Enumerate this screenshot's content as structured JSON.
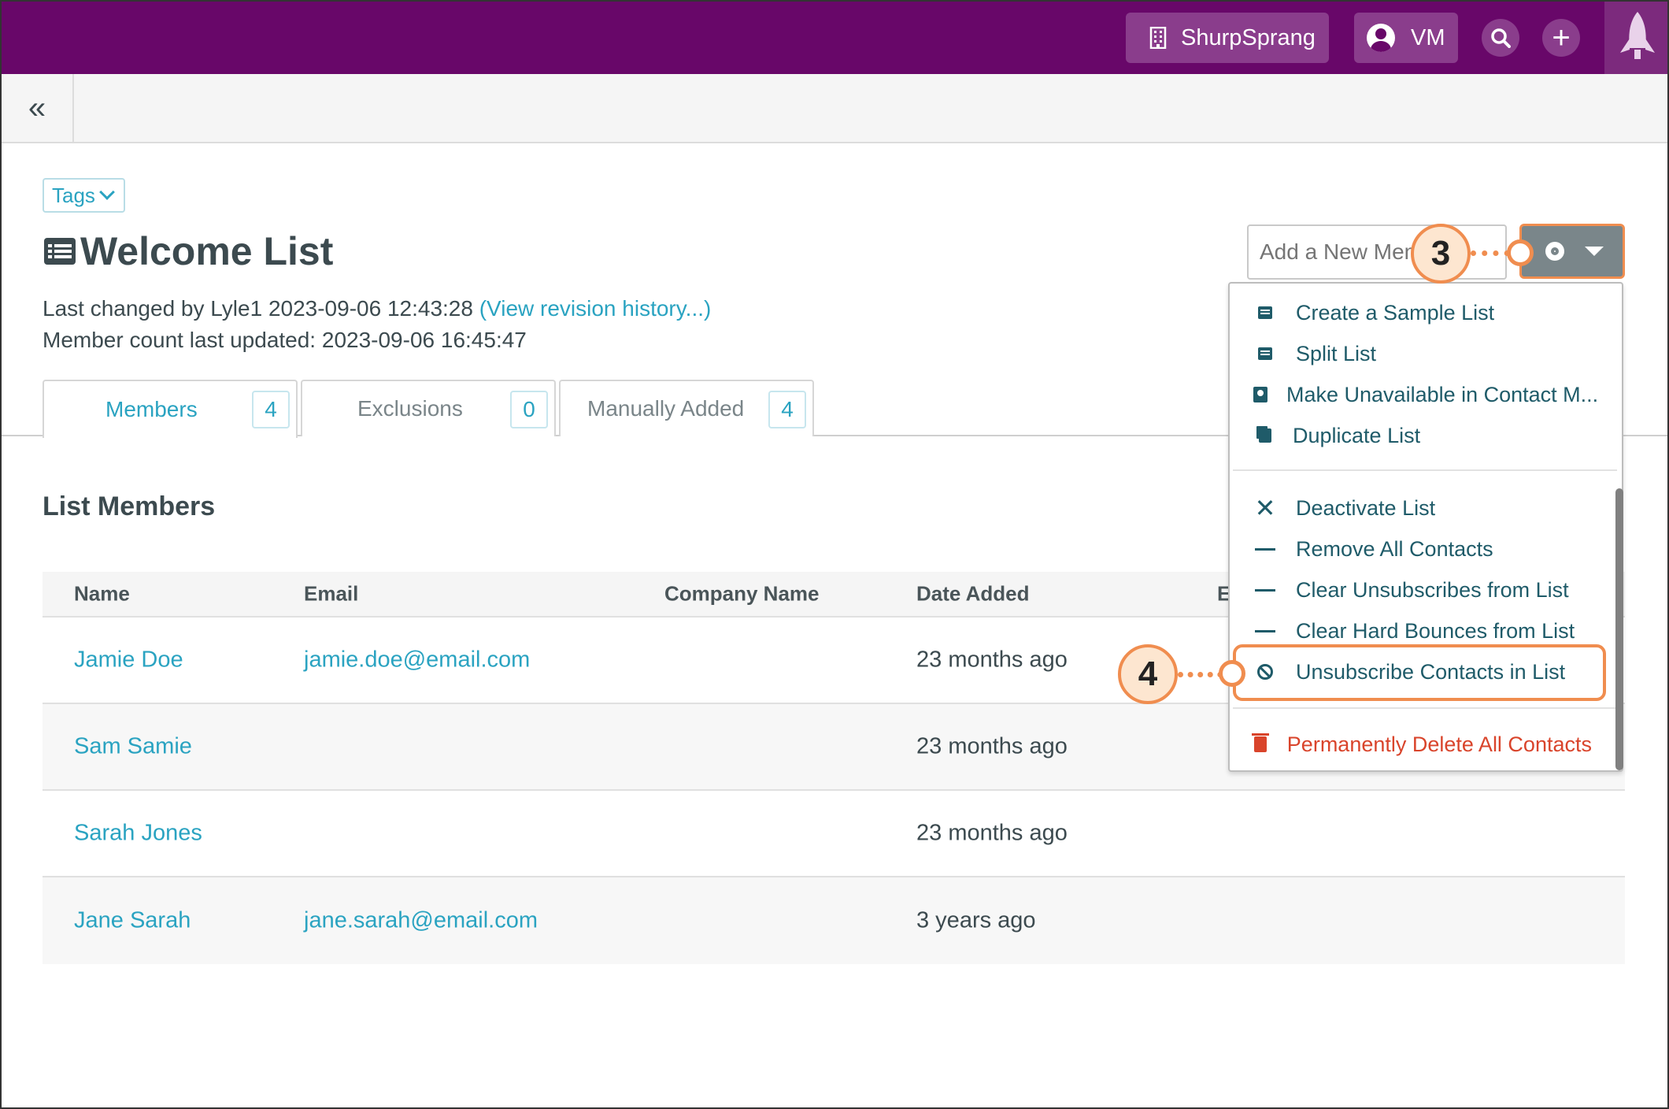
{
  "topbar": {
    "org_name": "ShurpSprang",
    "user_initials": "VM",
    "plus_label": "+"
  },
  "subbar": {
    "collapse_label": "«"
  },
  "tags": {
    "label": "Tags"
  },
  "list": {
    "title": "Welcome List",
    "last_changed": "Last changed by Lyle1 2023-09-06 12:43:28 ",
    "revision_link": "(View revision history...)",
    "member_count_updated": "Member count last updated: 2023-09-06 16:45:47"
  },
  "tabs": [
    {
      "label": "Members",
      "count": "4"
    },
    {
      "label": "Exclusions",
      "count": "0"
    },
    {
      "label": "Manually Added",
      "count": "4"
    }
  ],
  "section_title": "List Members",
  "table": {
    "headers": [
      "Name",
      "Email",
      "Company Name",
      "Date Added",
      "E"
    ],
    "rows": [
      {
        "name": "Jamie Doe",
        "email": "jamie.doe@email.com",
        "company": "",
        "date": "23 months ago"
      },
      {
        "name": "Sam Samie",
        "email": "",
        "company": "",
        "date": "23 months ago"
      },
      {
        "name": "Sarah Jones",
        "email": "",
        "company": "",
        "date": "23 months ago"
      },
      {
        "name": "Jane Sarah",
        "email": "jane.sarah@email.com",
        "company": "",
        "date": "3 years ago"
      }
    ]
  },
  "add_member": {
    "placeholder": "Add a New Member"
  },
  "menu": {
    "items": [
      {
        "label": "Create a Sample List",
        "icon": "list-icon"
      },
      {
        "label": "Split List",
        "icon": "list-icon"
      },
      {
        "label": "Make Unavailable in Contact M...",
        "icon": "contact-book-icon"
      },
      {
        "label": "Duplicate List",
        "icon": "copy-icon"
      },
      {
        "label": "Deactivate List",
        "icon": "x-icon"
      },
      {
        "label": "Remove All Contacts",
        "icon": "dash-icon"
      },
      {
        "label": "Clear Unsubscribes from List",
        "icon": "dash-icon"
      },
      {
        "label": "Clear Hard Bounces from List",
        "icon": "dash-icon"
      },
      {
        "label": "Unsubscribe Contacts in List",
        "icon": "ban-icon"
      },
      {
        "label": "Permanently Delete All Contacts",
        "icon": "trash-icon"
      }
    ]
  },
  "callouts": {
    "step3": "3",
    "step4": "4"
  },
  "colors": {
    "topbar": "#680769",
    "accent": "#2aa3c1",
    "callout": "#f08d4f",
    "danger": "#d9442b"
  }
}
